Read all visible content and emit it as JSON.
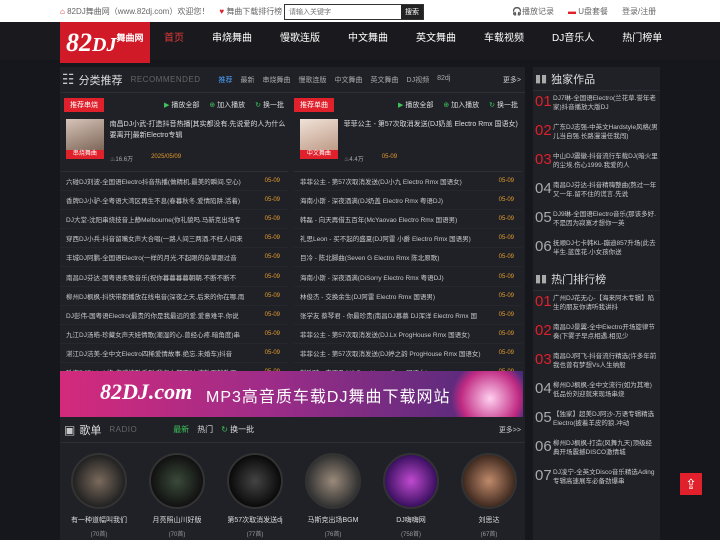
{
  "topbar": {
    "home": "82DJ舞曲网（www.82dj.com）欢迎您！",
    "fav": "舞曲下载排行榜",
    "search_placeholder": "请输入关键字",
    "search_btn": "搜索",
    "play_record": "播放记录",
    "usb": "U盘套餐",
    "login": "登录/注册"
  },
  "logo": {
    "main": "82",
    "mid": "DJ",
    "sub": "舞曲网",
    ".com": ".com"
  },
  "nav": [
    "首页",
    "串烧舞曲",
    "慢歌连版",
    "中文舞曲",
    "英文舞曲",
    "车载视频",
    "DJ音乐人",
    "热门榜单"
  ],
  "recommend": {
    "title": "分类推荐",
    "en": "RECOMMENDED",
    "tabs": [
      "推荐",
      "最新",
      "串烧舞曲",
      "慢歌连版",
      "中文舞曲",
      "英文舞曲",
      "DJ视频",
      "82dj"
    ],
    "more": "更多>"
  },
  "left": {
    "badge": "推荐串烧",
    "acts": [
      "播放全部",
      "加入播放",
      "换一批"
    ],
    "feat": {
      "thumb_label": "串烧舞曲",
      "text": "南昌DJ小武-打造抖音热播[其实都没有.先说爱的人为什么要离开]最新Electro专辑",
      "stat": "16.6万",
      "date": "2025/05/09"
    },
    "rows": [
      [
        "六碰DJ刘波-全国语Electro抖音热播(做精机.最美的瞬间.空心)",
        "05-09"
      ],
      [
        "香牌DJ小驴-全粤语大湾区再生不息(春暮秋冬.爱情陷阱.活着)",
        "05-09"
      ],
      [
        "DJ大堂-沈阳串烧技音上静Melbourne(你礼貌吗.马新克出场专",
        "05-09"
      ],
      [
        "穿西DJ小兵-抖音留嘴女声大合唱(一路人间三两酒.不枉人间来",
        "05-09"
      ],
      [
        "丰城DJ阿鹏-全国语Electro(一样的月光.不起眼的杂草跟过音",
        "05-09"
      ],
      [
        "南昌DJ芬达-国粤语柔歌音乐(祝你暮暮暮暮朝朝.不断不断不",
        "05-09"
      ],
      [
        "柳州DJ枫枫-抖快带都播放在线电音(深夜之天.后来的你在哪.雨",
        "05-09"
      ],
      [
        "DJ彭伟-国粤语Electro(最贵的你是我最远的爱.爱意难平.你说",
        "05-09"
      ],
      [
        "九江DJ汤皓-珍藏女声天娃情歌(潮湿的心.曾经心疼.暗角度)串",
        "05-09"
      ],
      [
        "湛江DJ洁美-全中文Electro四稀爱情故事.绝忘.未婚车)抖音",
        "05-09"
      ],
      [
        "珠海DJRickvf-终-伤感情歌系列(我怎么都不对.波放下就放下.",
        "05-09"
      ]
    ]
  },
  "right": {
    "badge": "推荐单曲",
    "acts": [
      "播放全部",
      "加入播放",
      "换一批"
    ],
    "feat": {
      "thumb_label": "中文舞曲",
      "text": "菲菲公主 - 第57次取消发送(DJ奶盖 Electro Rmx 国语女)",
      "stat": "4.4万",
      "date": "05-09"
    },
    "rows": [
      [
        "菲菲公主 - 第57次取消发送(DJ小九 Electro Rmx 国语女)",
        "05-09"
      ],
      [
        "海南小斯 - 深夜酒满(DJ奶盖 Electro Rmx 粤语DJ)",
        "05-09"
      ],
      [
        "韩磊 - 向天再借五百年(McYaovao Electro Rmx 国语男)",
        "05-09"
      ],
      [
        "礼思Leon - 买不起的盛夏(DJ阿雷 小爵 Electro Rmx 国语男)",
        "05-09"
      ],
      [
        "目冷 - 陈北脚曲(Seven G Electro Rmx 陈北原歌)",
        "05-09"
      ],
      [
        "海南小斯 - 深夜酒满(DiSorry Electro Rmx 粤语DJ)",
        "05-09"
      ],
      [
        "林俊杰 - 交换余生(DJ阿雷 Electro Rmx 国语男)",
        "05-09"
      ],
      [
        "张学友 蔡琴君 - 你最珍贵(南昌DJ慕慕 DJ浑洋 Electro Rmx 国",
        "05-09"
      ],
      [
        "菲菲公主 - 第57次取消发送(DJ.Lx ProgHouse Rmx 国语女)",
        "05-09"
      ],
      [
        "菲菲公主 - 第57次取消发送(DJ婷之韵 ProgHouse Rmx 国语女)",
        "05-09"
      ],
      [
        "刘瑞琦 - 来不及(K6 ProgHouse Rmx 国语女)",
        "05-09"
      ]
    ]
  },
  "banner": {
    "logo": "82DJ.com",
    "text": "MP3高音质车载DJ舞曲下载网站"
  },
  "songs": {
    "title": "歌单",
    "en": "RADIO",
    "tabs": [
      "最新",
      "热门",
      "换一批"
    ],
    "more": "更多>>",
    "items": [
      [
        "有一种道幅叫我们",
        "(70首)"
      ],
      [
        "月亮照山川好版",
        "(70首)"
      ],
      [
        "第57次取消发送dj",
        "(77首)"
      ],
      [
        "马斯克出场BGM",
        "(76首)"
      ],
      [
        "DJ嗨嗨网",
        "(758首)"
      ],
      [
        "刘思达",
        "(67首)"
      ]
    ]
  },
  "side": {
    "hot_title": "独家作品",
    "hot": [
      [
        "01",
        "DJ7琳-全国语Electro(兰花草.誉年老家)抖音播放大版DJ"
      ],
      [
        "02",
        "广东DJ志强-中英文Hardstyle风格(男儿当自强.长路漫漫任我闯)"
      ],
      [
        "03",
        "中山DJ震徽-抖音流行车载DJ(暗火里的尘埃.伤心1999.我爱的人"
      ],
      [
        "04",
        "南昌DJ芬达-抖音精嗨整曲(熬过一年又一年.留不住的谎言.先说"
      ],
      [
        "05",
        "DJ9琳-全国语Electro音乐(那该多好.不是因为寂寞才想你一英"
      ],
      [
        "06",
        "抚顺DJ七卡韩KL-蹦迪857升场(此去半生.蓝莲花.小女孩你送"
      ]
    ],
    "rank_title": "热门排行榜",
    "rank": [
      [
        "01",
        "广州DJ花无心-【海来阿木专辑】陷生的朋友你请听我讲抖"
      ],
      [
        "02",
        "南昌DJ景翼-全中Electro开场旋律节奏(下雾子早点相遇.相见少"
      ],
      [
        "03",
        "南昌DJ阿飞-抖音流行精选(许多年前我也曾有梦想Vs人生纳般"
      ],
      [
        "04",
        "柳州DJ枫枫-全中文流行(如为其难)低品份刘迎就来现场串烧"
      ],
      [
        "05",
        "【独家】超美DJ阿沙-万语专辑精选Electro(披着羊皮的狼.冲动"
      ],
      [
        "06",
        "柳州DJ枫枫-打造(风舞九天)顶级经典开场震撼DISCO激情城"
      ],
      [
        "07",
        "DJ凌宁-全英文Disco音乐精选Ading专辑高速展车必备劲爆串"
      ]
    ]
  },
  "colors": {
    "accent": "#e0202a",
    "date": "#e59b2b",
    "tab_on": "#4ea3ff"
  }
}
